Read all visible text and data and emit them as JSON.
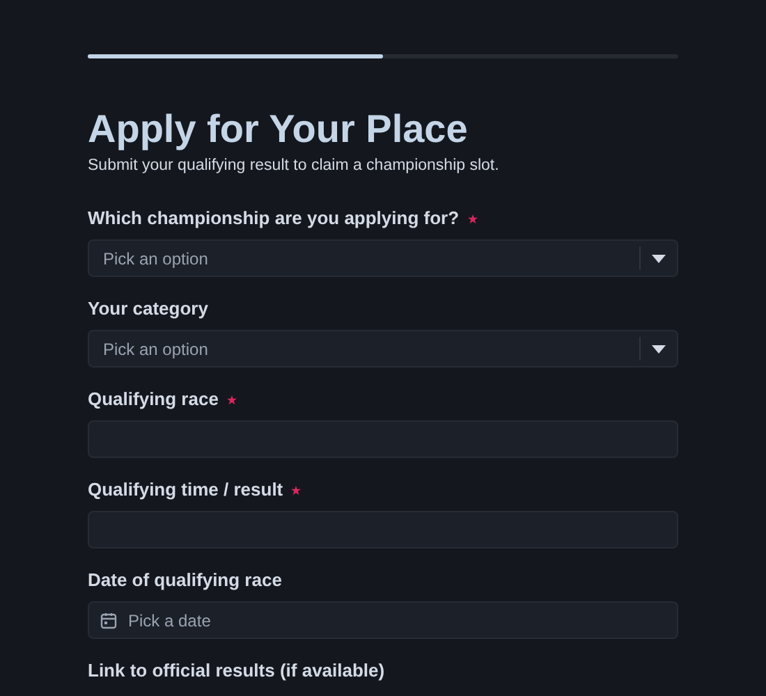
{
  "progress": {
    "level": 0.5
  },
  "title": "Apply for Your Place",
  "subtitle": "Submit your qualifying result to claim a championship slot.",
  "fields": [
    {
      "kind": "select",
      "label": "Which championship are you applying for?",
      "required": true,
      "placeholder": "Pick an option"
    },
    {
      "kind": "select",
      "label": "Your category",
      "required": false,
      "placeholder": "Pick an option"
    },
    {
      "kind": "text",
      "label": "Qualifying race",
      "required": true
    },
    {
      "kind": "text",
      "label": "Qualifying time / result",
      "required": true
    },
    {
      "kind": "date",
      "label": "Date of qualifying race",
      "required": false,
      "placeholder": "Pick a date"
    },
    {
      "kind": "label",
      "label": "Link to official results (if available)",
      "required": false
    }
  ]
}
